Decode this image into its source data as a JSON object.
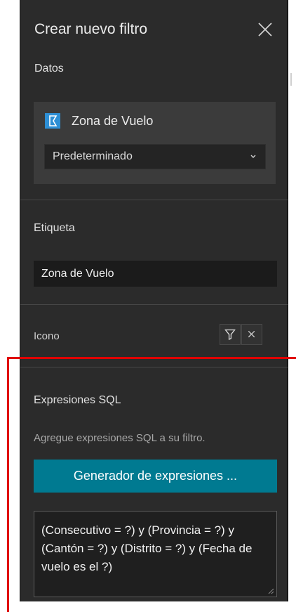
{
  "panel": {
    "title": "Crear nuevo filtro",
    "close_icon": "close-icon"
  },
  "data_section": {
    "label": "Datos",
    "layer_name": "Zona de Vuelo",
    "layer_icon": "layer-icon",
    "layer_icon_color": "#2d8fd5",
    "view_select_value": "Predeterminado"
  },
  "label_section": {
    "label": "Etiqueta",
    "value": "Zona de Vuelo"
  },
  "icon_section": {
    "label": "Icono",
    "filter_icon": "filter-icon",
    "clear_icon": "close-icon"
  },
  "sql_section": {
    "label": "Expresiones SQL",
    "hint": "Agregue expresiones SQL a su filtro.",
    "builder_button": "Generador de expresiones ...",
    "builder_button_color": "#007a91",
    "expression": "(Consecutivo = ?) y (Provincia = ?) y (Cantón = ?) y (Distrito = ?) y (Fecha de vuelo es el ?)"
  },
  "annotation": {
    "color": "#e00000"
  }
}
